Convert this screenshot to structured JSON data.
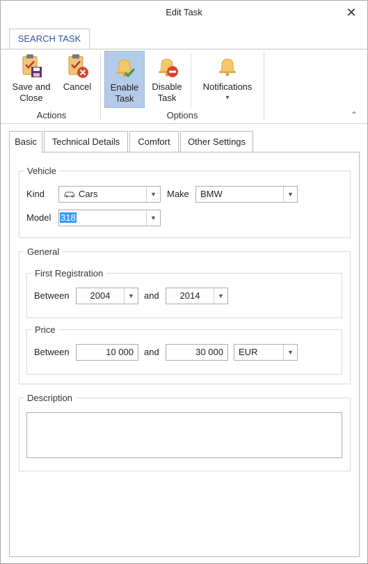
{
  "window": {
    "title": "Edit Task",
    "close_glyph": "✕"
  },
  "ribbon": {
    "tab_label": "SEARCH TASK",
    "buttons": {
      "save_close": {
        "line1": "Save and",
        "line2": "Close",
        "icon": "clipboard-save-icon"
      },
      "cancel": {
        "line1": "Cancel",
        "icon": "clipboard-cancel-icon"
      },
      "enable": {
        "line1": "Enable",
        "line2": "Task",
        "icon": "bell-check-icon"
      },
      "disable": {
        "line1": "Disable",
        "line2": "Task",
        "icon": "bell-disable-icon"
      },
      "notifications": {
        "line1": "Notifications",
        "arrow": "▾",
        "icon": "bell-icon"
      }
    },
    "groups": {
      "actions": "Actions",
      "options": "Options"
    },
    "collapse_glyph": "⌃"
  },
  "tabs": [
    "Basic",
    "Technical Details",
    "Comfort",
    "Other Settings"
  ],
  "vehicle": {
    "legend": "Vehicle",
    "kind_label": "Kind",
    "kind_value": "Cars",
    "kind_icon": "car-icon",
    "make_label": "Make",
    "make_value": "BMW",
    "model_label": "Model",
    "model_value": "318"
  },
  "general": {
    "legend": "General",
    "first_registration": {
      "legend": "First Registration",
      "between_label": "Between",
      "from": "2004",
      "and_label": "and",
      "to": "2014"
    },
    "price": {
      "legend": "Price",
      "between_label": "Between",
      "from": "10 000",
      "and_label": "and",
      "to": "30 000",
      "currency": "EUR"
    }
  },
  "description": {
    "legend": "Description",
    "value": ""
  },
  "colors": {
    "accent": "#2b579a",
    "active_button": "#b3cbe8",
    "selection": "#3399ff",
    "bell": "#f5c76a"
  }
}
